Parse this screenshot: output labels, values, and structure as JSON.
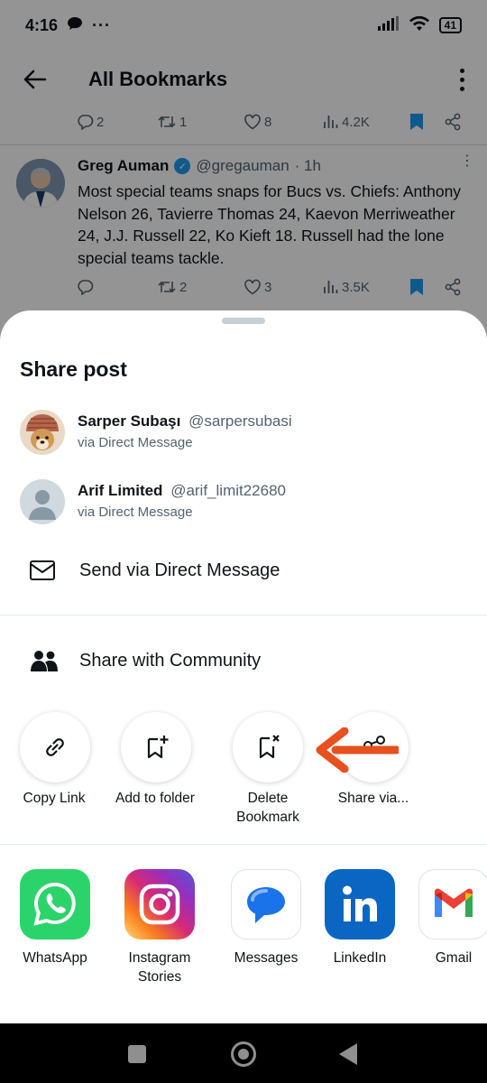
{
  "status_bar": {
    "time": "4:16",
    "dots": "···",
    "battery": "41"
  },
  "header": {
    "title": "All Bookmarks"
  },
  "prev_tweet": {
    "replies": "2",
    "retweets": "1",
    "likes": "8",
    "views": "4.2K"
  },
  "tweet": {
    "name": "Greg Auman",
    "handle": "@gregauman",
    "time": "· 1h",
    "text": "Most special teams snaps for Bucs vs. Chiefs: Anthony Nelson 26, Tavierre Thomas 24, Kaevon Merriweather 24, J.J. Russell 22, Ko Kieft 18. Russell had the lone special teams tackle.",
    "replies": "",
    "retweets": "2",
    "likes": "3",
    "views": "3.5K"
  },
  "sheet": {
    "title": "Share post",
    "contacts": [
      {
        "name": "Sarper Subaşı",
        "handle": "@sarpersubasi",
        "via": "via Direct Message"
      },
      {
        "name": "Arif Limited",
        "handle": "@arif_limit22680",
        "via": "via Direct Message"
      }
    ],
    "send_dm": "Send via Direct Message",
    "share_community": "Share with Community",
    "actions": [
      {
        "label": "Copy Link"
      },
      {
        "label": "Add to folder"
      },
      {
        "label": "Delete Bookmark"
      },
      {
        "label": "Share via..."
      }
    ],
    "apps": [
      {
        "label": "WhatsApp"
      },
      {
        "label": "Instagram Stories"
      },
      {
        "label": "Messages"
      },
      {
        "label": "LinkedIn"
      },
      {
        "label": "Gmail"
      }
    ]
  },
  "colors": {
    "accent": "#1d9bf0",
    "bookmark": "#1d9bf0",
    "annotation_arrow": "#e8501e",
    "whatsapp": "#25d366",
    "linkedin": "#0a66c2"
  },
  "icons": [
    "back-arrow-icon",
    "more-vertical-icon",
    "reply-icon",
    "retweet-icon",
    "like-icon",
    "views-icon",
    "bookmark-icon",
    "share-icon",
    "mail-icon",
    "community-icon",
    "link-icon",
    "add-folder-icon",
    "delete-bookmark-icon",
    "share-via-icon"
  ]
}
